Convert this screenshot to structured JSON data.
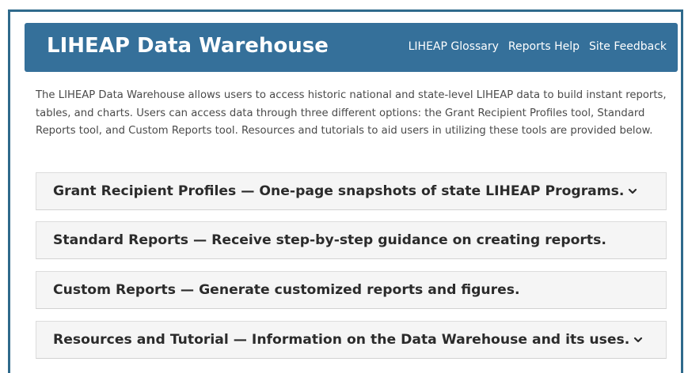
{
  "header": {
    "title": "LIHEAP Data Warehouse",
    "nav": [
      {
        "label": "LIHEAP Glossary"
      },
      {
        "label": "Reports Help"
      },
      {
        "label": "Site Feedback"
      }
    ],
    "background_color": "#35709a"
  },
  "intro": {
    "text": "The LIHEAP Data Warehouse allows users to access historic national and state-level LIHEAP data to build instant reports, tables, and charts. Users can access data through three different options: the Grant Recipient Profiles tool, Standard Reports tool, and Custom Reports tool. Resources and tutorials to aid users in utilizing these tools are provided below."
  },
  "accordion": [
    {
      "label": "Grant Recipient Profiles — One-page snapshots of state LIHEAP Programs.",
      "icon": "chevron-down-icon"
    },
    {
      "label": "Standard Reports — Receive step-by-step guidance on creating reports.",
      "icon": ""
    },
    {
      "label": "Custom Reports — Generate customized reports and figures.",
      "icon": ""
    },
    {
      "label": "Resources and Tutorial — Information on the Data Warehouse and its uses.",
      "icon": "chevron-down-icon"
    }
  ]
}
